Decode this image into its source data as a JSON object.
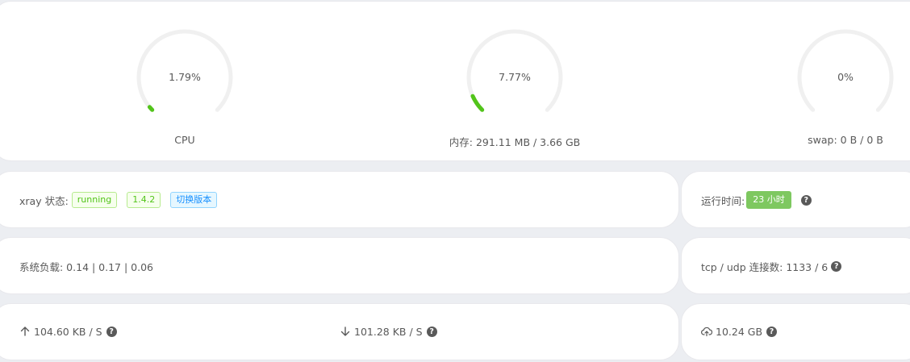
{
  "gauges": {
    "cpu": {
      "value_text": "1.79%",
      "label": "CPU",
      "percent": 1.79
    },
    "memory": {
      "value_text": "7.77%",
      "label": "内存: 291.11 MB / 3.66 GB",
      "percent": 7.77
    },
    "swap": {
      "value_text": "0%",
      "label": "swap: 0 B / 0 B",
      "percent": 0
    }
  },
  "xray": {
    "label": "xray 状态:",
    "status": "running",
    "version": "1.4.2",
    "switch_label": "切换版本"
  },
  "uptime": {
    "label": "运行时间:",
    "value": "23 小时",
    "help": "?"
  },
  "load": {
    "text": "系统负载: 0.14 | 0.17 | 0.06"
  },
  "connections": {
    "text": "tcp / udp 连接数: 1133 / 6",
    "help": "?"
  },
  "traffic": {
    "upload": "104.60 KB / S",
    "upload_help": "?",
    "download": "101.28 KB / S",
    "download_help": "?",
    "total": "10.24 GB",
    "total_help": "?"
  },
  "colors": {
    "gauge_fill": "#52c41a",
    "gauge_track": "#f0f0f0",
    "tag_green": "#52c41a",
    "tag_blue": "#1890ff",
    "uptime_badge": "#7ec860"
  },
  "icons": {
    "upload": "arrow-up-icon",
    "download": "arrow-down-icon",
    "total": "cloud-upload-icon",
    "help": "question-circle-icon"
  }
}
